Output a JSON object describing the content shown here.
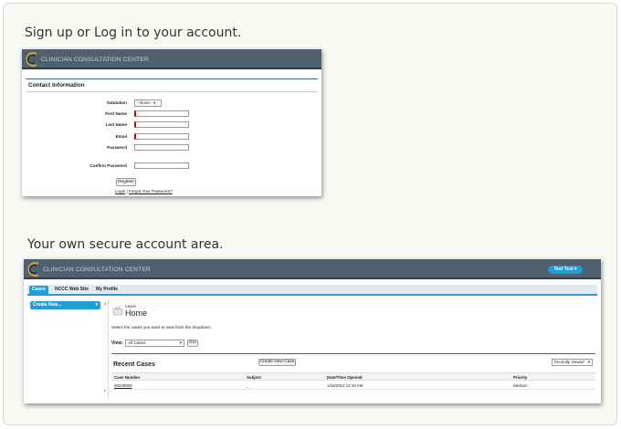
{
  "section1": {
    "heading": "Sign up or Log in to your account.",
    "brand": "CLINICIAN CONSULTATION CENTER",
    "form_title": "Contact Information",
    "fields": {
      "salutation_label": "Salutation",
      "salutation_value": "--None--",
      "first_name_label": "First Name",
      "last_name_label": "Last Name",
      "email_label": "Email",
      "password_label": "Password",
      "confirm_password_label": "Confirm Password"
    },
    "register_label": "Register",
    "login_link": "Login",
    "separator": "|",
    "forgot_link": "Forgot Your Password?"
  },
  "section2": {
    "heading": "Your own secure account area.",
    "brand": "CLINICIAN CONSULTATION CENTER",
    "user_menu": "Test Test",
    "tabs": [
      "Cases",
      "NCCC Web Site",
      "My Profile"
    ],
    "create_new": "Create New...",
    "page_small": "Cases",
    "page_title": "Home",
    "instruction": "Select the cases you want to view from the dropdown.",
    "view_label": "View:",
    "view_value": "All Cases",
    "go_label": "Go!",
    "recent_title": "Recent Cases",
    "create_case_label": "Create New Case",
    "recent_select": "Recently Viewed",
    "columns": [
      "Case Number",
      "Subject",
      "Date/Time Opened",
      "Priority"
    ],
    "rows": [
      {
        "case_number": "00249909",
        "subject": "_",
        "opened": "1/16/2014 12:19 AM",
        "priority": "Medium"
      }
    ]
  }
}
